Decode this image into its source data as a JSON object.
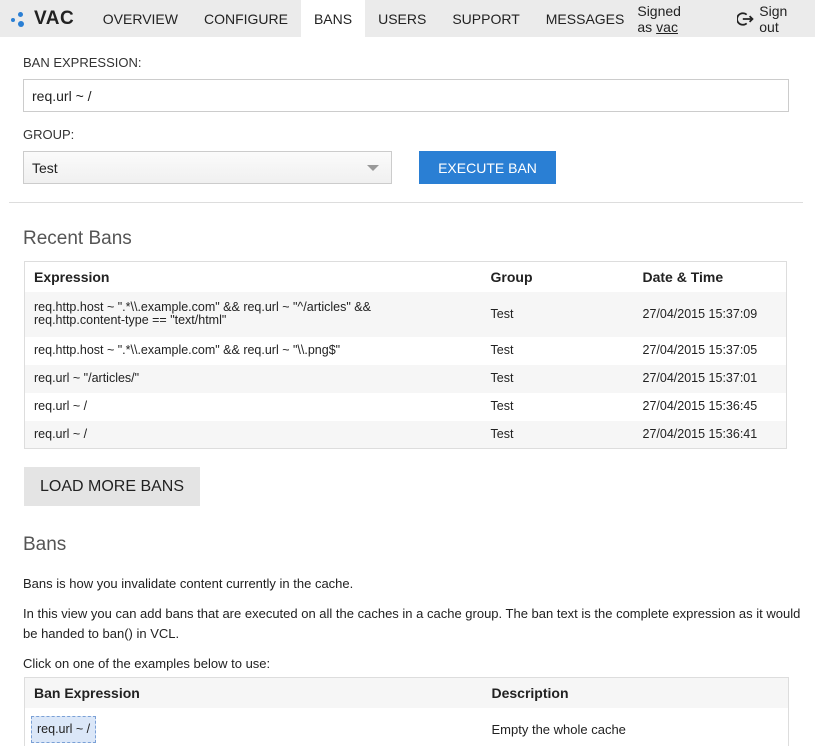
{
  "brand": {
    "name": "VAC"
  },
  "nav": {
    "tabs": [
      {
        "label": "OVERVIEW"
      },
      {
        "label": "CONFIGURE"
      },
      {
        "label": "BANS"
      },
      {
        "label": "USERS"
      },
      {
        "label": "SUPPORT"
      },
      {
        "label": "MESSAGES"
      }
    ],
    "signed_as": "Signed as",
    "user": "vac",
    "signout": "Sign out"
  },
  "form": {
    "expression_label": "BAN EXPRESSION:",
    "expression_value": "req.url ~ /",
    "group_label": "GROUP:",
    "group_value": "Test",
    "execute_label": "EXECUTE BAN"
  },
  "recent": {
    "title": "Recent Bans",
    "headers": [
      "Expression",
      "Group",
      "Date & Time"
    ],
    "rows": [
      {
        "expr1": "req.http.host ~ \".*\\\\.example.com\" && req.url ~ \"^/articles\" &&",
        "expr2": "req.http.content-type == \"text/html\"",
        "group": "Test",
        "time": "27/04/2015 15:37:09"
      },
      {
        "expr1": "req.http.host ~ \".*\\\\.example.com\" && req.url ~ \"\\\\.png$\"",
        "expr2": "",
        "group": "Test",
        "time": "27/04/2015 15:37:05"
      },
      {
        "expr1": "req.url ~ \"/articles/\"",
        "expr2": "",
        "group": "Test",
        "time": "27/04/2015 15:37:01"
      },
      {
        "expr1": "req.url ~ /",
        "expr2": "",
        "group": "Test",
        "time": "27/04/2015 15:36:45"
      },
      {
        "expr1": "req.url ~ /",
        "expr2": "",
        "group": "Test",
        "time": "27/04/2015 15:36:41"
      }
    ],
    "load_more": "LOAD MORE BANS"
  },
  "help": {
    "title": "Bans",
    "p1": "Bans is how you invalidate content currently in the cache.",
    "p2a": "In this view you can add bans that are executed on all the caches in a cache group. The ban text is the complete expression as it would",
    "p2b": "be handed to ban() in VCL.",
    "p3": "Click on one of the examples below to use:",
    "headers": [
      "Ban Expression",
      "Description"
    ],
    "examples": [
      {
        "expr": "req.url ~ /",
        "desc": "Empty the whole cache"
      }
    ]
  },
  "colors": {
    "accent": "#2a7fd4",
    "nav_bg": "#ebebeb"
  },
  "icons": {
    "brand": "dots-logo-icon",
    "signout": "sign-out-icon",
    "select_caret": "caret-down-icon"
  }
}
